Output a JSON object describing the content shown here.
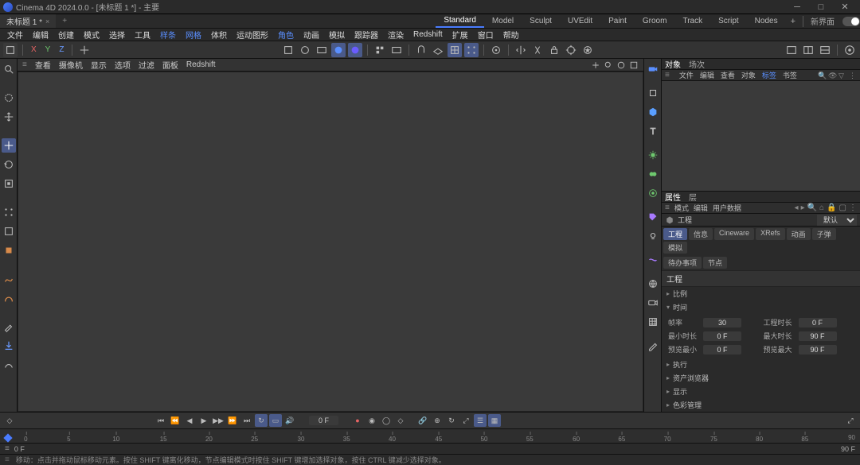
{
  "title": "Cinema 4D 2024.0.0 - [未标题 1 *] - 主要",
  "doc_tab": {
    "label": "未标题 1 *",
    "close": "×"
  },
  "layout_tabs": [
    "Standard",
    "Model",
    "Sculpt",
    "UVEdit",
    "Paint",
    "Groom",
    "Track",
    "Script",
    "Nodes"
  ],
  "layout_active": 0,
  "layout_new": "新界面",
  "menus": [
    "文件",
    "编辑",
    "创建",
    "模式",
    "选择",
    "工具",
    "样条",
    "网格",
    "体积",
    "运动图形",
    "角色",
    "动画",
    "模拟",
    "跟踪器",
    "渲染",
    "Redshift",
    "扩展",
    "窗口",
    "帮助"
  ],
  "accent_menus": [
    6,
    7
  ],
  "axes": {
    "x": "X",
    "y": "Y",
    "z": "Z"
  },
  "viewport_menus": [
    "查看",
    "摄像机",
    "显示",
    "选项",
    "过滤",
    "面板",
    "Redshift"
  ],
  "object_mgr": {
    "tabs": [
      "对象",
      "场次"
    ],
    "menus": [
      "文件",
      "编辑",
      "查看",
      "对象",
      "标签",
      "书签"
    ]
  },
  "attr_mgr": {
    "tabs": [
      "属性",
      "层"
    ],
    "menus": [
      "模式",
      "编辑",
      "用户数据"
    ],
    "proj_label": "工程",
    "mode_select": "默认",
    "attr_tabs": [
      "工程",
      "信息",
      "Cineware",
      "XRefs",
      "动画",
      "子弹",
      "模拟",
      "待办事项",
      "节点"
    ],
    "attr_tabs_group2": [
      "待办事项",
      "节点"
    ],
    "section_main": "工程",
    "sections": [
      {
        "label": "比例",
        "open": false
      },
      {
        "label": "时间",
        "open": true
      },
      {
        "label": "执行",
        "open": false
      },
      {
        "label": "资产浏览器",
        "open": false
      },
      {
        "label": "显示",
        "open": false
      },
      {
        "label": "色彩管理",
        "open": false
      }
    ],
    "time_fields": {
      "fps_label": "帧率",
      "fps": "30",
      "projlen_label": "工程时长",
      "projlen": "0 F",
      "minlen_label": "最小时长",
      "minlen": "0 F",
      "maxlen_label": "最大时长",
      "maxlen": "90 F",
      "premin_label": "预览最小",
      "premin": "0 F",
      "premax_label": "预览最大",
      "premax": "90 F"
    }
  },
  "timeline": {
    "frame": "0 F",
    "ticks": [
      0,
      5,
      10,
      15,
      20,
      25,
      30,
      35,
      40,
      45,
      50,
      55,
      60,
      65,
      70,
      75,
      80,
      85,
      90
    ],
    "end": "90",
    "range_start": "0 F",
    "range_end": "90 F"
  },
  "statusbar": "移动：点击并拖动鼠标移动元素。按住 SHIFT 键离化移动，节点编辑模式时按住 SHIFT 键增加选择对象，按住 CTRL 键减少选择对象。"
}
